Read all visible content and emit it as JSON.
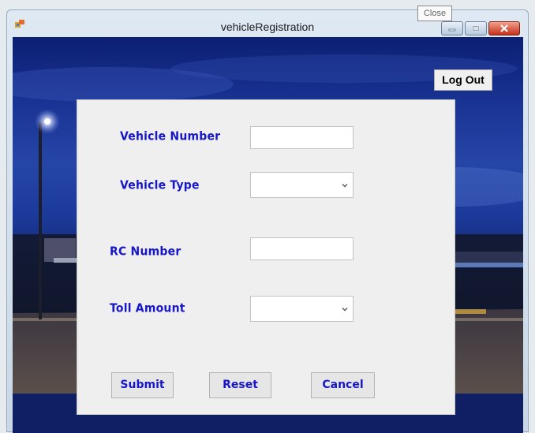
{
  "window": {
    "title": "vehicleRegistration",
    "close_tooltip": "Close",
    "app_icon": "app-icon"
  },
  "header": {
    "logout_label": "Log Out"
  },
  "form": {
    "vehicle_number_label": "Vehicle Number",
    "vehicle_number_value": "",
    "vehicle_type_label": "Vehicle Type",
    "vehicle_type_value": "",
    "rc_number_label": "RC Number",
    "rc_number_value": "",
    "toll_amount_label": "Toll Amount",
    "toll_amount_value": ""
  },
  "buttons": {
    "submit_label": "Submit",
    "reset_label": "Reset",
    "cancel_label": "Cancel"
  },
  "colors": {
    "label_text": "#1717c9",
    "sky_dark": "#0c1f73",
    "panel_bg": "#efefef"
  }
}
